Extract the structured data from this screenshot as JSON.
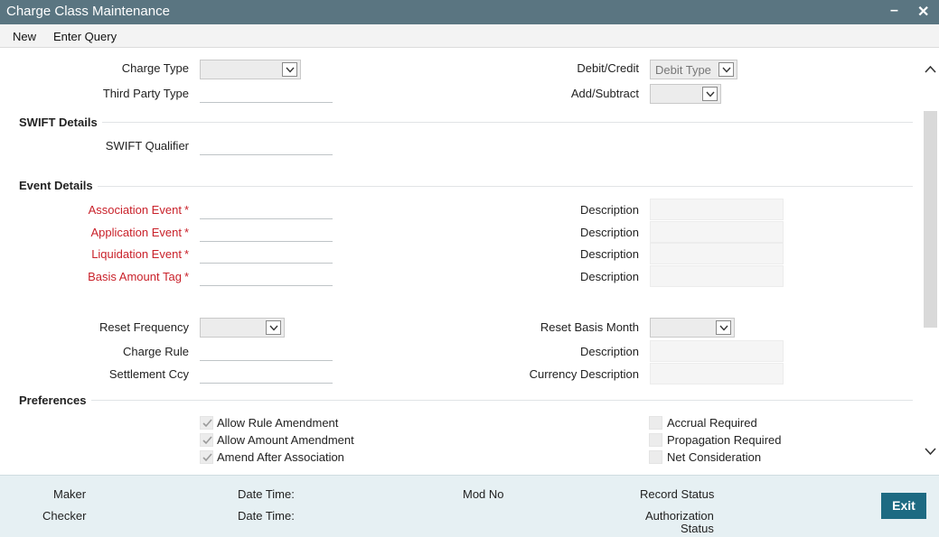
{
  "window": {
    "title": "Charge Class Maintenance",
    "minimize": "–",
    "close": "✕"
  },
  "menu": {
    "new": "New",
    "enter_query": "Enter Query"
  },
  "main": {
    "charge_type": {
      "label": "Charge Type",
      "value": ""
    },
    "third_party_type": {
      "label": "Third Party Type",
      "value": ""
    },
    "debit_credit": {
      "label": "Debit/Credit",
      "value": "Debit Type"
    },
    "add_subtract": {
      "label": "Add/Subtract",
      "value": ""
    }
  },
  "swift": {
    "heading": "SWIFT Details",
    "qualifier_label": "SWIFT Qualifier"
  },
  "events": {
    "heading": "Event Details",
    "association_label": "Association Event",
    "application_label": "Application Event",
    "liquidation_label": "Liquidation Event",
    "basis_amount_label": "Basis Amount Tag",
    "required_mark": "*",
    "description_label": "Description"
  },
  "reset": {
    "frequency_label": "Reset Frequency",
    "basis_month_label": "Reset Basis Month",
    "charge_rule_label": "Charge Rule",
    "description_label": "Description",
    "settlement_ccy_label": "Settlement Ccy",
    "currency_description_label": "Currency Description"
  },
  "preferences": {
    "heading": "Preferences",
    "allow_rule_amendment": {
      "label": "Allow Rule Amendment",
      "checked": true
    },
    "allow_amount_amendment": {
      "label": "Allow Amount Amendment",
      "checked": true
    },
    "amend_after_association": {
      "label": "Amend After Association",
      "checked": true
    },
    "accrual_required": {
      "label": "Accrual Required",
      "checked": false
    },
    "propagation_required": {
      "label": "Propagation Required",
      "checked": false
    },
    "net_consideration": {
      "label": "Net Consideration",
      "checked": false
    }
  },
  "footer": {
    "maker": "Maker",
    "checker": "Checker",
    "date_time": "Date Time:",
    "mod_no": "Mod No",
    "record_status": "Record Status",
    "authorization": "Authorization",
    "status": "Status",
    "exit": "Exit"
  },
  "colors": {
    "titlebar": "#5a7581",
    "required": "#c9212a",
    "exit_button": "#1d6a82",
    "footer": "#e6f0f3"
  },
  "icons": [
    "minimize-icon",
    "close-icon",
    "chevron-down-icon",
    "scroll-up-icon",
    "scroll-down-icon",
    "checkmark-icon"
  ]
}
